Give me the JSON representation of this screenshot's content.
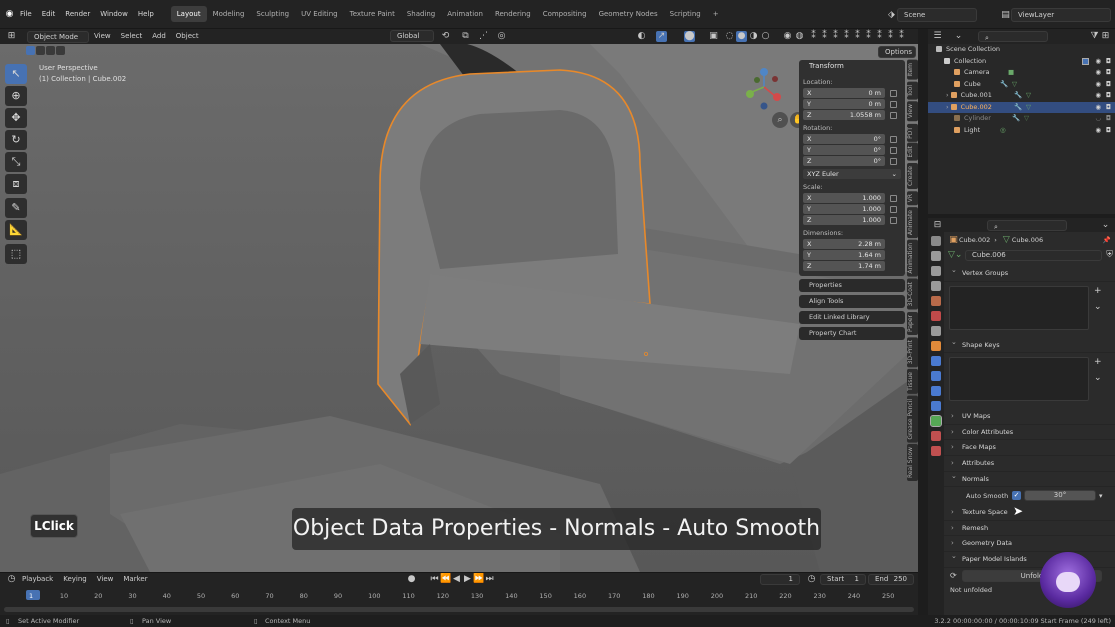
{
  "topbar": {
    "menus": [
      "File",
      "Edit",
      "Render",
      "Window",
      "Help"
    ],
    "workspaces": [
      "Layout",
      "Modeling",
      "Sculpting",
      "UV Editing",
      "Texture Paint",
      "Shading",
      "Animation",
      "Rendering",
      "Compositing",
      "Geometry Nodes",
      "Scripting"
    ],
    "active_workspace": "Layout",
    "add_tab": "+",
    "scene": "Scene",
    "view_layer": "ViewLayer"
  },
  "viewport_header": {
    "mode": "Object Mode",
    "menus": [
      "View",
      "Select",
      "Add",
      "Object"
    ],
    "transform_orientation": "Global",
    "options": "Options"
  },
  "viewport": {
    "perspective": "User Perspective",
    "collection_info": "(1) Collection | Cube.002"
  },
  "npanel": {
    "transform_title": "Transform",
    "location_label": "Location:",
    "location": [
      {
        "axis": "X",
        "value": "0 m"
      },
      {
        "axis": "Y",
        "value": "0 m"
      },
      {
        "axis": "Z",
        "value": "1.0558 m"
      }
    ],
    "rotation_label": "Rotation:",
    "rotation": [
      {
        "axis": "X",
        "value": "0°"
      },
      {
        "axis": "Y",
        "value": "0°"
      },
      {
        "axis": "Z",
        "value": "0°"
      }
    ],
    "rotation_mode": "XYZ Euler",
    "scale_label": "Scale:",
    "scale": [
      {
        "axis": "X",
        "value": "1.000"
      },
      {
        "axis": "Y",
        "value": "1.000"
      },
      {
        "axis": "Z",
        "value": "1.000"
      }
    ],
    "dimensions_label": "Dimensions:",
    "dimensions": [
      {
        "axis": "X",
        "value": "2.28 m"
      },
      {
        "axis": "Y",
        "value": "1.64 m"
      },
      {
        "axis": "Z",
        "value": "1.74 m"
      }
    ],
    "subpanels": [
      "Properties",
      "Align Tools",
      "Edit Linked Library",
      "Property Chart"
    ]
  },
  "vertical_tabs": [
    "Item",
    "Tool",
    "View",
    "PDT",
    "Edit",
    "Create",
    "VR",
    "Animate",
    "Animation",
    "3D-Coat",
    "Paper",
    "3D-Print",
    "Tissue",
    "Grease Pencil",
    "Real Snow"
  ],
  "outliner": {
    "root": "Scene Collection",
    "collection": "Collection",
    "items": [
      {
        "name": "Camera",
        "color": "#e0a060",
        "selected": false
      },
      {
        "name": "Cube",
        "color": "#e0a060",
        "selected": false
      },
      {
        "name": "Cube.001",
        "color": "#e0a060",
        "selected": false
      },
      {
        "name": "Cube.002",
        "color": "#e0a060",
        "selected": true
      },
      {
        "name": "Cylinder",
        "color": "#8a7050",
        "selected": false
      },
      {
        "name": "Light",
        "color": "#e0a060",
        "selected": false
      }
    ]
  },
  "properties": {
    "breadcrumb_object": "Cube.002",
    "breadcrumb_mesh": "Cube.006",
    "mesh_name": "Cube.006",
    "sections": {
      "vertex_groups": "Vertex Groups",
      "shape_keys": "Shape Keys",
      "uv_maps": "UV Maps",
      "color_attributes": "Color Attributes",
      "face_maps": "Face Maps",
      "attributes": "Attributes",
      "normals": "Normals",
      "texture_space": "Texture Space",
      "remesh": "Remesh",
      "geometry_data": "Geometry Data",
      "paper_model_islands": "Paper Model Islands"
    },
    "auto_smooth_label": "Auto Smooth",
    "auto_smooth_checked": true,
    "auto_smooth_angle": "30°",
    "unfold_label": "Unfold",
    "not_unfolded": "Not unfolded"
  },
  "timeline": {
    "menus": [
      "Playback",
      "Keying",
      "View",
      "Marker"
    ],
    "current_frame": "1",
    "start_label": "Start",
    "start": "1",
    "end_label": "End",
    "end": "250",
    "ticks": [
      "1",
      "10",
      "20",
      "30",
      "40",
      "50",
      "60",
      "70",
      "80",
      "90",
      "100",
      "110",
      "120",
      "130",
      "140",
      "150",
      "160",
      "170",
      "180",
      "190",
      "200",
      "210",
      "220",
      "230",
      "240",
      "250"
    ]
  },
  "statusbar": {
    "left": "Set Active Modifier",
    "middle": "Pan View",
    "right": "Context Menu",
    "info": "3.2.2   00:00:00:00 / 00:00:10:09   Start Frame (249 left)"
  },
  "overlay": {
    "caption": "Object Data Properties - Normals - Auto Smooth",
    "key_hint": "LClick"
  },
  "colors": {
    "accent": "#4772b3",
    "selection_outline": "#e8892a",
    "background": "#1d1d1d"
  }
}
